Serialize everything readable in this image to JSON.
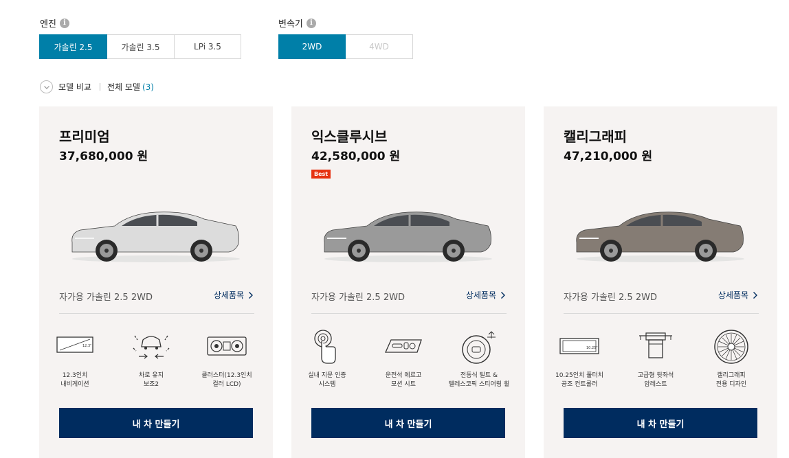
{
  "filters": {
    "engine": {
      "label": "엔진",
      "options": [
        "가솔린 2.5",
        "가솔린 3.5",
        "LPi 3.5"
      ],
      "selected": "가솔린 2.5"
    },
    "drive": {
      "label": "변속기",
      "options": [
        "2WD",
        "4WD"
      ],
      "selected": "2WD",
      "disabled": [
        "4WD"
      ]
    }
  },
  "compare": {
    "toggle_label": "모델 비교",
    "all_models_label": "전체 모델",
    "count": "(3)"
  },
  "colors": {
    "accent": "#007fa8",
    "navy": "#002c5f",
    "badge": "#e63312",
    "card_bg": "#f6f3f2"
  },
  "cards": [
    {
      "name": "프리미엄",
      "price": "37,680,000 원",
      "badge": "",
      "car_color": "#dcdcdc",
      "trim": "자가용 가솔린 2.5 2WD",
      "detail_label": "상세품목",
      "features": [
        {
          "icon": "navigation-screen-icon",
          "text": "12.3인치\n내비게이션"
        },
        {
          "icon": "lane-keeping-icon",
          "text": "차로 유지\n보조2"
        },
        {
          "icon": "cluster-display-icon",
          "text": "클러스터(12.3인치\n컬러 LCD)"
        }
      ],
      "build_label": "내 차 만들기"
    },
    {
      "name": "익스클루시브",
      "price": "42,580,000 원",
      "badge": "Best",
      "car_color": "#9a9a9a",
      "trim": "자가용 가솔린 2.5 2WD",
      "detail_label": "상세품목",
      "features": [
        {
          "icon": "fingerprint-touch-icon",
          "text": "실내 지문 인증\n시스템"
        },
        {
          "icon": "seat-control-icon",
          "text": "운전석 에르고\n모션 시트"
        },
        {
          "icon": "steering-wheel-icon",
          "text": "전동식 틸트 &\n텔레스코픽 스티어링 휠"
        }
      ],
      "build_label": "내 차 만들기"
    },
    {
      "name": "캘리그래피",
      "price": "47,210,000 원",
      "badge": "",
      "car_color": "#857c74",
      "trim": "자가용 가솔린 2.5 2WD",
      "detail_label": "상세품목",
      "features": [
        {
          "icon": "touch-controller-icon",
          "text": "10.25인치 풀터치\n공조 컨트롤러"
        },
        {
          "icon": "rear-armrest-icon",
          "text": "고급형 뒷좌석\n암레스트"
        },
        {
          "icon": "calligraphy-wheel-icon",
          "text": "캘리그래피\n전용 디자인"
        }
      ],
      "build_label": "내 차 만들기"
    }
  ]
}
